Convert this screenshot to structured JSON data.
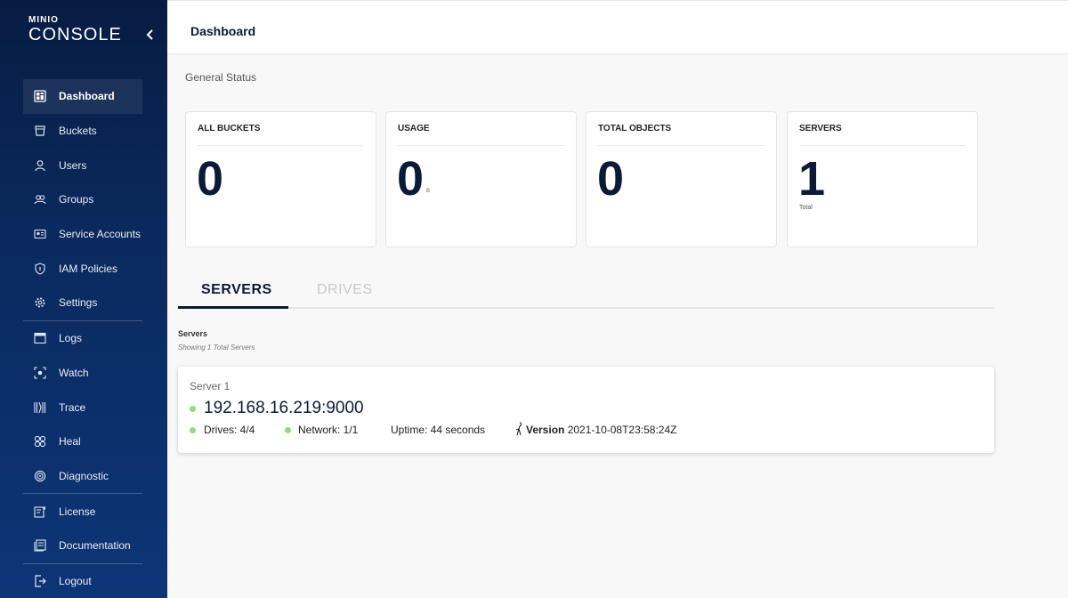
{
  "brand": {
    "small": "MINIO",
    "big": "CONSOLE"
  },
  "sidebar": {
    "items": [
      {
        "label": "Dashboard",
        "icon": "dashboard-icon",
        "active": true
      },
      {
        "label": "Buckets",
        "icon": "bucket-icon"
      },
      {
        "label": "Users",
        "icon": "user-icon"
      },
      {
        "label": "Groups",
        "icon": "groups-icon"
      },
      {
        "label": "Service Accounts",
        "icon": "service-accounts-icon"
      },
      {
        "label": "IAM Policies",
        "icon": "shield-icon"
      },
      {
        "label": "Settings",
        "icon": "gear-icon"
      },
      {
        "label": "Logs",
        "icon": "logs-icon"
      },
      {
        "label": "Watch",
        "icon": "watch-icon"
      },
      {
        "label": "Trace",
        "icon": "trace-icon"
      },
      {
        "label": "Heal",
        "icon": "heal-icon"
      },
      {
        "label": "Diagnostic",
        "icon": "diagnostic-icon"
      },
      {
        "label": "License",
        "icon": "license-icon"
      },
      {
        "label": "Documentation",
        "icon": "documentation-icon"
      },
      {
        "label": "Logout",
        "icon": "logout-icon"
      }
    ]
  },
  "header": {
    "title": "Dashboard"
  },
  "general_status": {
    "label": "General Status"
  },
  "cards": {
    "buckets": {
      "title": "ALL BUCKETS",
      "value": "0"
    },
    "usage": {
      "title": "USAGE",
      "value": "0",
      "unit": "B"
    },
    "objects": {
      "title": "TOTAL OBJECTS",
      "value": "0"
    },
    "servers": {
      "title": "SERVERS",
      "value": "1",
      "sub": "Total"
    }
  },
  "tabs": {
    "servers": "SERVERS",
    "drives": "DRIVES"
  },
  "servers_section": {
    "title": "Servers",
    "subtitle": "Showing 1 Total Servers"
  },
  "server": {
    "name": "Server 1",
    "address": "192.168.16.219:9000",
    "drives": "Drives: 4/4",
    "network": "Network: 1/1",
    "uptime": "Uptime: 44 seconds",
    "version_label": "Version",
    "version": "2021-10-08T23:58:24Z"
  },
  "colors": {
    "sidebar": "#0a2a5e",
    "online": "#8fdc7c",
    "accent": "#0b1a36"
  }
}
